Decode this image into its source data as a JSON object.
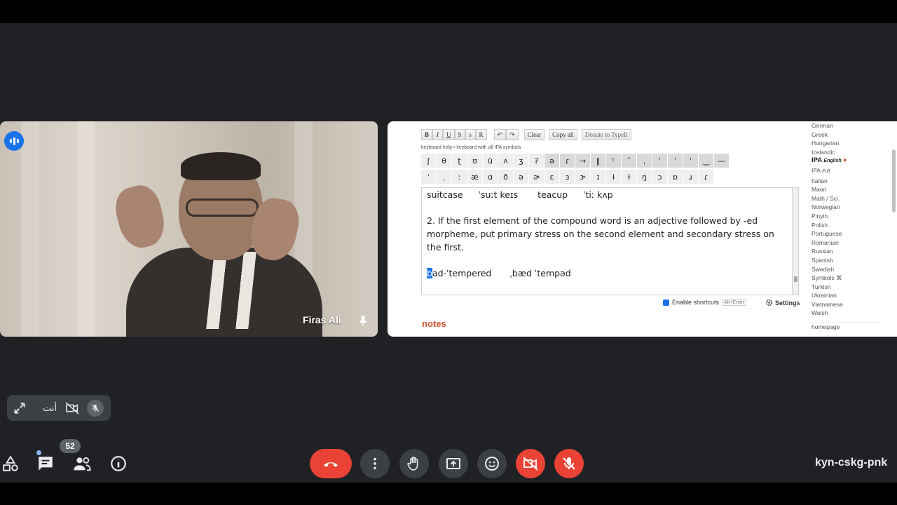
{
  "participant": {
    "name": "Firas Ali"
  },
  "editor_toolbar": {
    "format_buttons": [
      "B",
      "I",
      "U",
      "S",
      "s",
      "R"
    ],
    "undo": "↶",
    "redo": "↷",
    "clear": "Clear",
    "copy_all": "Copy all",
    "donate": "Donate to TypeIt"
  },
  "help_text": "keyboard help • keyboard with all IPA symbols",
  "symbols_row1": [
    "ʃ",
    "θ",
    "ʈ",
    "ʊ",
    "ü",
    "ʌ",
    "ʒ",
    "ʔ",
    "ə",
    "ɾ",
    "→",
    "‖",
    "ᵗ",
    "˜",
    "ˌ",
    "ˈ",
    "ˈ",
    "ˈ",
    "‿",
    "—"
  ],
  "symbols_row2": [
    "ˈ",
    "ˌ",
    "ː",
    "æ",
    "ɑ",
    "ð",
    "ə",
    "ɚ",
    "ɛ",
    "ɜ",
    "ɝ",
    "ɪ",
    "ɨ",
    "ɫ",
    "ŋ",
    "ɔ",
    "ɒ",
    "ɹ",
    "ɾ"
  ],
  "editor": {
    "line1_word": "suitcase",
    "line1_ipa": "ˈsuːt keɪs",
    "line1_word2": "teacup",
    "line1_ipa2": "ˈtiː kʌp",
    "paragraph": "2. If the first element of the compound word is an adjective followed by -ed morpheme, put primary stress on the second element and secondary stress on the first.",
    "example_cursor": "b",
    "example_rest": "ad-ˈtempered",
    "example_ipa": "ˌbæd ˈtempəd"
  },
  "shortcuts": {
    "label": "Enable shortcuts",
    "key": "Alt+Enter",
    "settings": "Settings"
  },
  "notes_label": "notes",
  "languages": [
    "German",
    "Greek",
    "Hungarian",
    "Icelandic"
  ],
  "language_selected": "IPA",
  "language_selected_sub": "English",
  "languages_after": [
    "Italian",
    "Maori",
    "Math / Sci.",
    "Norwegian",
    "Pinyin",
    "Polish",
    "Portuguese",
    "Romanian",
    "Russian",
    "Spanish",
    "Swedish",
    "Symbols ⌘",
    "Turkish",
    "Ukrainian",
    "Vietnamese",
    "Welsh"
  ],
  "ipa_full": "IPA",
  "ipa_full_sub": "Full",
  "homepage": "homepage",
  "self_view": {
    "label": "أنت"
  },
  "chat_count": "52",
  "meeting_code": "kyn-cskg-pnk",
  "colors": {
    "hangup": "#ea4335",
    "accent": "#1a73e8",
    "notes": "#d0532f"
  }
}
